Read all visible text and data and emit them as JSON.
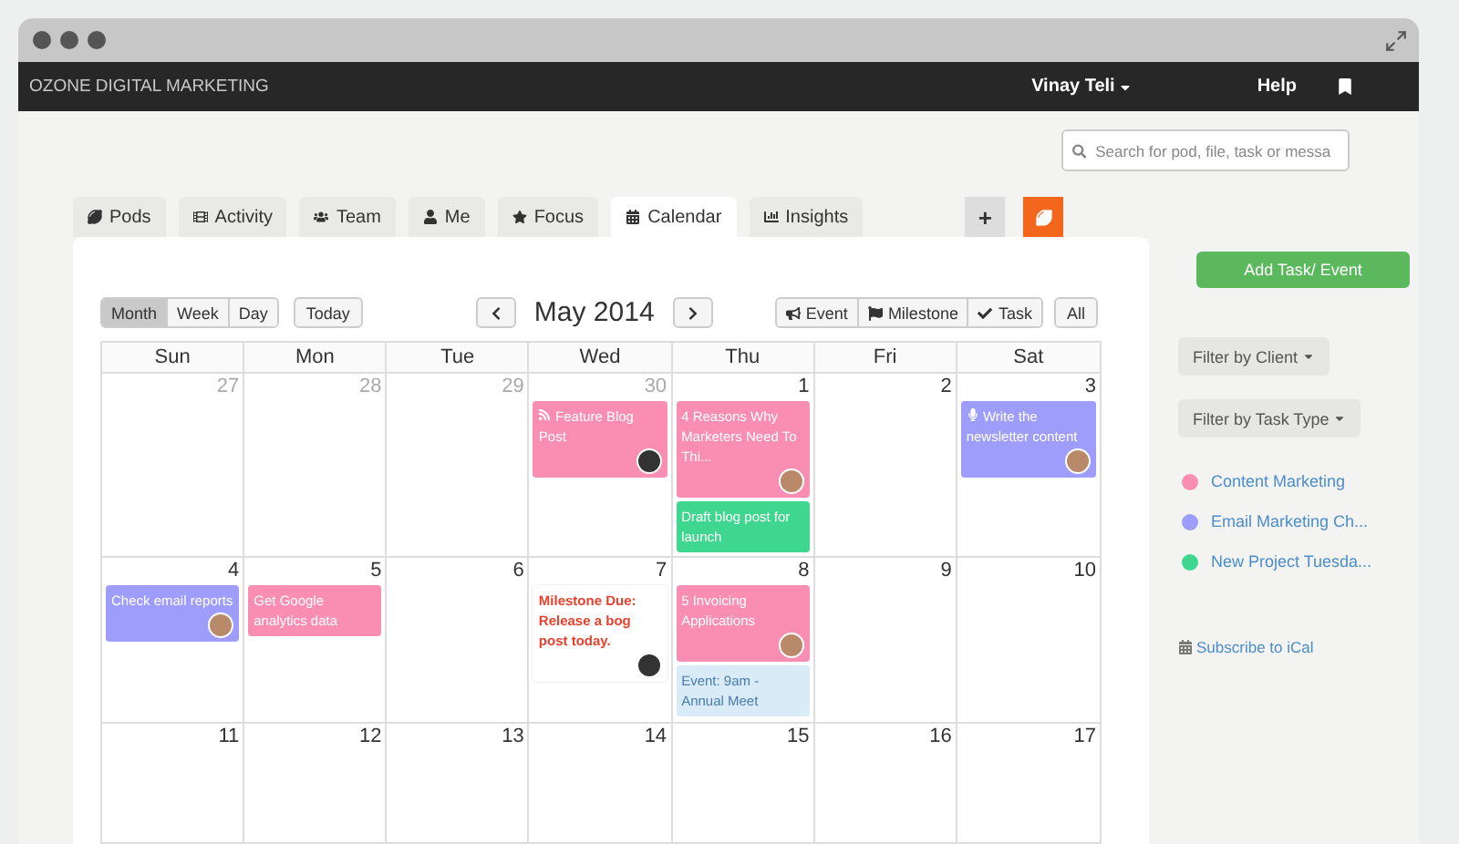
{
  "app": {
    "brand": "OZONE DIGITAL MARKETING",
    "user": "Vinay Teli",
    "help": "Help"
  },
  "search": {
    "placeholder": "Search for pod, file, task or messa"
  },
  "tabs": [
    {
      "label": "Pods",
      "selected": false
    },
    {
      "label": "Activity",
      "selected": false
    },
    {
      "label": "Team",
      "selected": false
    },
    {
      "label": "Me",
      "selected": false
    },
    {
      "label": "Focus",
      "selected": false
    },
    {
      "label": "Calendar",
      "selected": true
    },
    {
      "label": "Insights",
      "selected": false
    }
  ],
  "add_tab": "+",
  "calendar": {
    "views": [
      {
        "label": "Month",
        "selected": true
      },
      {
        "label": "Week",
        "selected": false
      },
      {
        "label": "Day",
        "selected": false
      }
    ],
    "today": "Today",
    "title": "May 2014",
    "type_filters": [
      "Event",
      "Milestone",
      "Task"
    ],
    "all": "All",
    "weekdays": [
      "Sun",
      "Mon",
      "Tue",
      "Wed",
      "Thu",
      "Fri",
      "Sat"
    ],
    "weeks": [
      [
        {
          "day": "27",
          "other_month": true
        },
        {
          "day": "28",
          "other_month": true
        },
        {
          "day": "29",
          "other_month": true
        },
        {
          "day": "30",
          "other_month": true,
          "events": [
            {
              "kind": "post",
              "text": "Feature Blog Post",
              "color": "#f98eb2",
              "avatar": true
            }
          ]
        },
        {
          "day": "1",
          "other_month": false,
          "events": [
            {
              "kind": "task",
              "text": "4 Reasons Why Marketers Need To Thi...",
              "color": "#f98eb2",
              "avatar": true
            },
            {
              "kind": "task",
              "text": "Draft blog post for launch",
              "color": "#3fd68f",
              "avatar": false
            }
          ]
        },
        {
          "day": "2",
          "other_month": false
        },
        {
          "day": "3",
          "other_month": false,
          "events": [
            {
              "kind": "audio",
              "text": "Write the newsletter content",
              "color": "#9f9dfb",
              "avatar": true
            }
          ]
        }
      ],
      [
        {
          "day": "4",
          "other_month": false,
          "events": [
            {
              "kind": "task",
              "text": "Check email reports",
              "color": "#9f9dfb",
              "avatar": true
            }
          ]
        },
        {
          "day": "5",
          "other_month": false,
          "events": [
            {
              "kind": "task",
              "text": "Get Google analytics data",
              "color": "#f98eb2",
              "avatar": false
            }
          ]
        },
        {
          "day": "6",
          "other_month": false
        },
        {
          "day": "7",
          "other_month": false,
          "events": [
            {
              "kind": "milestone",
              "text": "Milestone Due: Release a bog post today.",
              "avatar": true
            }
          ]
        },
        {
          "day": "8",
          "other_month": false,
          "events": [
            {
              "kind": "task",
              "text": "5 Invoicing Applications",
              "color": "#f98eb2",
              "avatar": true
            },
            {
              "kind": "event",
              "text": "Event: 9am - Annual Meet",
              "avatar": false
            }
          ]
        },
        {
          "day": "9",
          "other_month": false
        },
        {
          "day": "10",
          "other_month": false
        }
      ],
      [
        {
          "day": "11",
          "other_month": false
        },
        {
          "day": "12",
          "other_month": false
        },
        {
          "day": "13",
          "other_month": false
        },
        {
          "day": "14",
          "other_month": false
        },
        {
          "day": "15",
          "other_month": false
        },
        {
          "day": "16",
          "other_month": false
        },
        {
          "day": "17",
          "other_month": false
        }
      ]
    ]
  },
  "sidebar": {
    "add_button": "Add Task/ Event",
    "filters": [
      "Filter by Client",
      "Filter by Task Type"
    ],
    "legend": [
      {
        "label": "Content Marketing",
        "color": "#f98eb2"
      },
      {
        "label": "Email Marketing Ch...",
        "color": "#9f9dfb"
      },
      {
        "label": "New Project Tuesda...",
        "color": "#3fd68f"
      }
    ],
    "subscribe": "Subscribe to iCal"
  }
}
